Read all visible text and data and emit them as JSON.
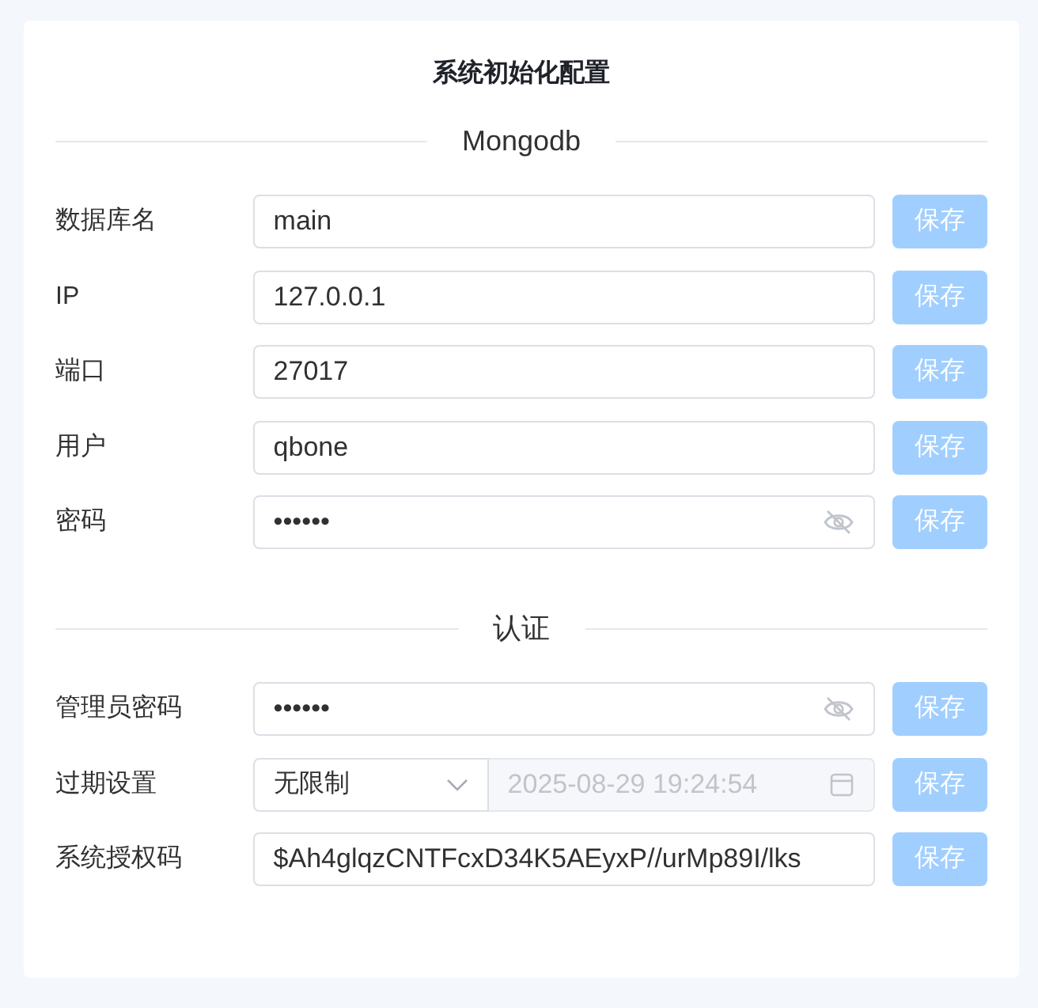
{
  "title": "系统初始化配置",
  "sections": [
    {
      "heading": "Mongodb",
      "fields": [
        {
          "label": "数据库名",
          "kind": "text",
          "value": "main",
          "button": {
            "label": "保存",
            "disabled": true
          }
        },
        {
          "label": "IP",
          "kind": "text",
          "value": "127.0.0.1",
          "button": {
            "label": "保存",
            "disabled": true
          }
        },
        {
          "label": "端口",
          "kind": "text",
          "value": "27017",
          "button": {
            "label": "保存",
            "disabled": true
          }
        },
        {
          "label": "用户",
          "kind": "text",
          "value": "qbone",
          "button": {
            "label": "保存",
            "disabled": true
          }
        },
        {
          "label": "密码",
          "kind": "password",
          "value": "••••••",
          "button": {
            "label": "保存",
            "disabled": true
          }
        }
      ]
    },
    {
      "heading": "认证",
      "fields": [
        {
          "label": "管理员密码",
          "kind": "password",
          "value": "••••••",
          "button": {
            "label": "保存",
            "disabled": true
          }
        },
        {
          "label": "过期设置",
          "kind": "select_date",
          "value": "无限制",
          "date": "2025-08-29 19:24:54",
          "date_disabled": true,
          "button": {
            "label": "保存",
            "disabled": true
          }
        },
        {
          "label": "系统授权码",
          "kind": "text",
          "value": "$Ah4glqzCNTFcxD34K5AEyxP//urMp89I/lks",
          "button": {
            "label": "保存",
            "disabled": true
          }
        }
      ]
    }
  ]
}
